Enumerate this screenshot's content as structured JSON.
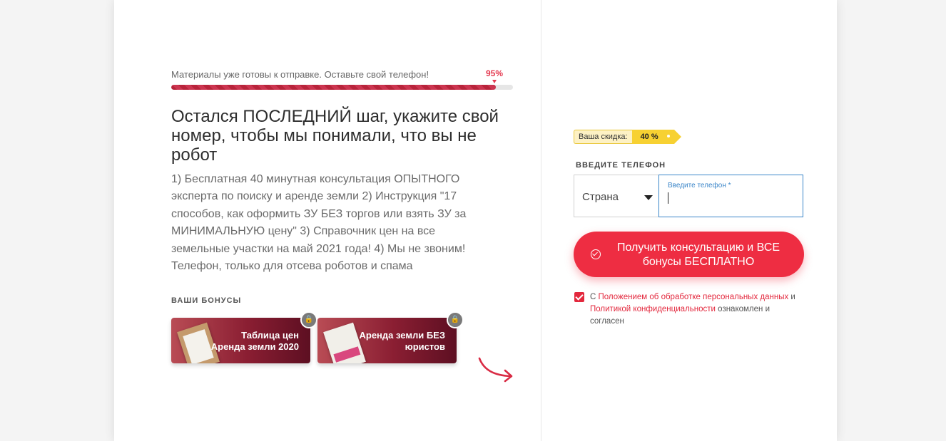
{
  "progress": {
    "text": "Материалы уже готовы к отправке. Оставьте свой телефон!",
    "percent_label": "95%",
    "value": 0.95
  },
  "heading": "Остался ПОСЛЕДНИЙ шаг, укажите свой номер, чтобы мы понимали, что вы не робот",
  "description": "1) Бесплатная 40 минутная консультация ОПЫТНОГО эксперта по поиску и аренде земли 2) Инструкция \"17 способов, как оформить ЗУ БЕЗ торгов или взять ЗУ за МИНИМАЛЬНУЮ цену\" 3) Справочник цен на все земельные участки на май 2021 года! 4) Мы не звоним! Телефон, только для отсева роботов и спама",
  "bonuses": {
    "title": "ВАШИ БОНУСЫ",
    "items": [
      {
        "label": "Таблица цен Аренда земли 2020",
        "icon": "lock-icon"
      },
      {
        "label": "Аренда земли БЕЗ юристов",
        "icon": "lock-icon"
      }
    ]
  },
  "discount": {
    "label": "Ваша скидка:",
    "value": "40 %"
  },
  "phone": {
    "label": "ВВЕДИТЕ ТЕЛЕФОН",
    "country_placeholder": "Страна",
    "input_placeholder": "Введите телефон *",
    "value": ""
  },
  "cta": {
    "label": "Получить консультацию и ВСЕ бонусы БЕСПЛАТНО"
  },
  "consent": {
    "prefix": "С",
    "link1": "Положением об обработке персональных данных",
    "middle": "и",
    "link2": "Политикой конфиденциальности",
    "suffix": "ознакомлен и согласен",
    "checked": true
  },
  "colors": {
    "accent": "#ee2d42",
    "link": "#e3283d",
    "input_focus": "#3b86c9",
    "discount_yellow": "#f7d132"
  }
}
